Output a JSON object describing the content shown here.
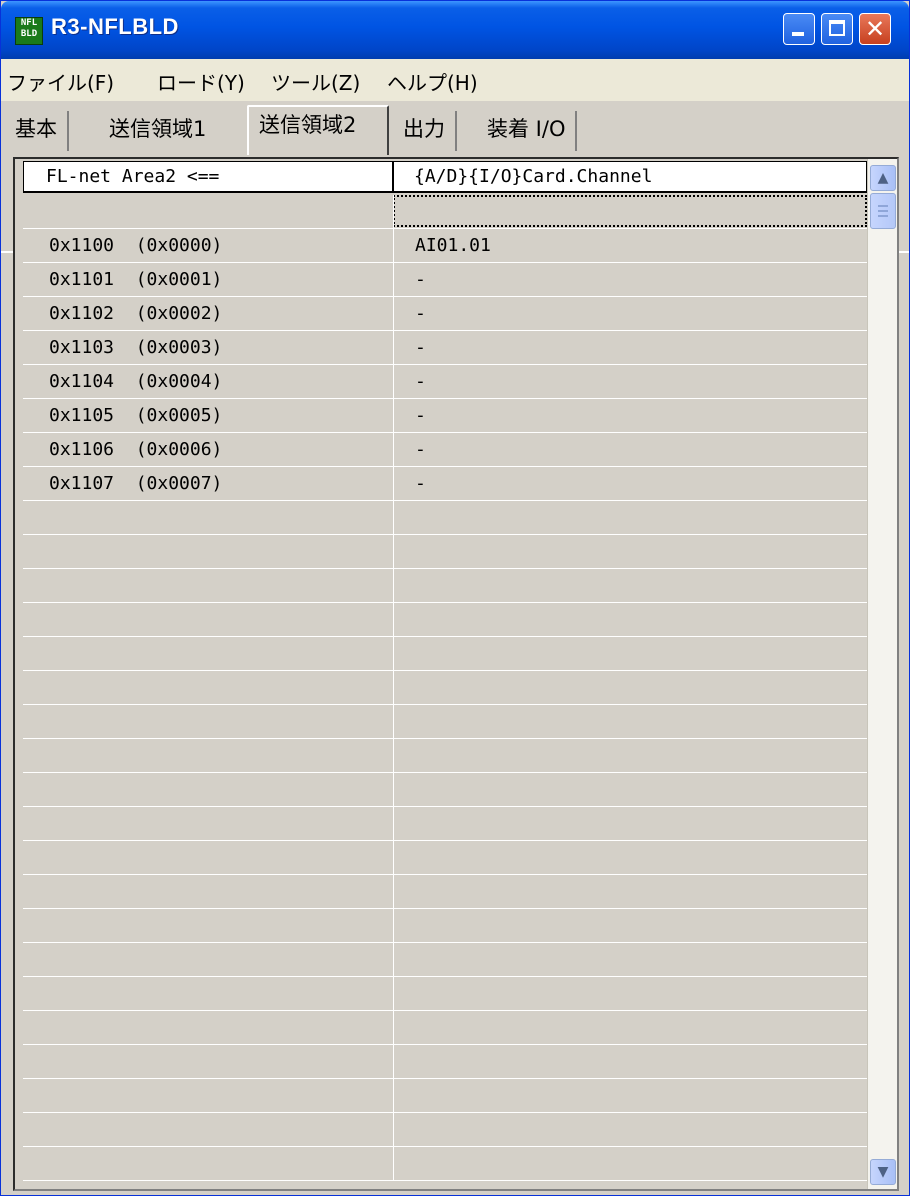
{
  "window": {
    "title": "R3-NFLBLD",
    "icon_label": "NFL BLD",
    "controls": {
      "minimize": "minimize-icon",
      "maximize": "maximize-icon",
      "close": "close-icon"
    }
  },
  "menu": [
    "ファイル(F)",
    "ロード(Y)",
    "ツール(Z)",
    "ヘルプ(H)"
  ],
  "tabs": [
    {
      "label": "基本"
    },
    {
      "label": "送信領域1"
    },
    {
      "label": "送信領域2",
      "active": true
    },
    {
      "label": "出力"
    },
    {
      "label": "装着 I/O"
    }
  ],
  "grid": {
    "columns": [
      "FL-net Area2    <==",
      "{A/D}{I/O}Card.Channel"
    ],
    "rows": [
      {
        "addr": "0x1100  (0x0000)",
        "value": "AI01.01"
      },
      {
        "addr": "0x1101  (0x0001)",
        "value": "-"
      },
      {
        "addr": "0x1102  (0x0002)",
        "value": "-"
      },
      {
        "addr": "0x1103  (0x0003)",
        "value": "-"
      },
      {
        "addr": "0x1104  (0x0004)",
        "value": "-"
      },
      {
        "addr": "0x1105  (0x0005)",
        "value": "-"
      },
      {
        "addr": "0x1106  (0x0006)",
        "value": "-"
      },
      {
        "addr": "0x1107  (0x0007)",
        "value": "-"
      }
    ]
  },
  "colors": {
    "titlebar": "#0054e3",
    "window_face": "#d4d0c8",
    "menu_bg": "#ece9d8",
    "close_button": "#c7401f"
  }
}
